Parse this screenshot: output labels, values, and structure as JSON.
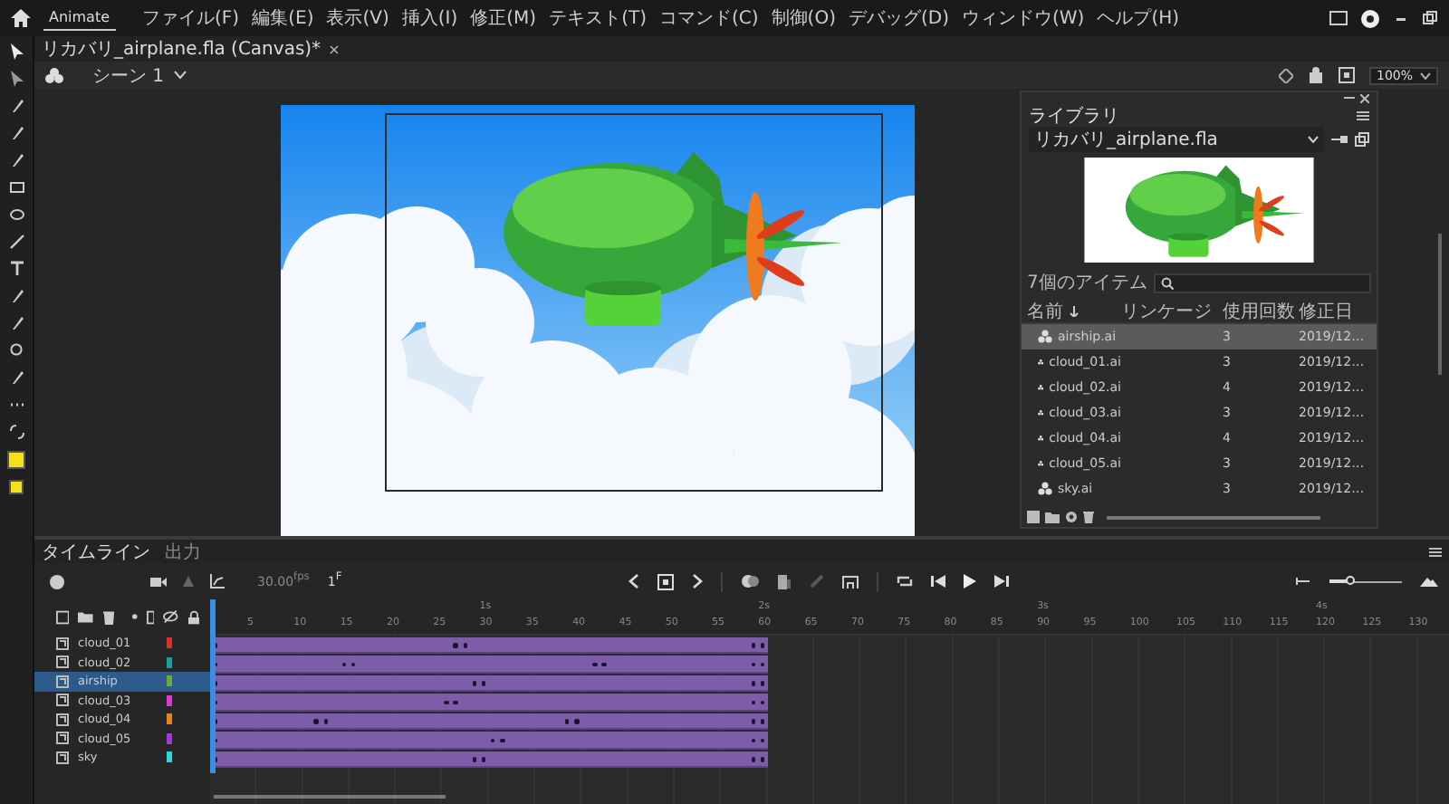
{
  "app": {
    "name": "Animate",
    "menus": [
      "ファイル(F)",
      "編集(E)",
      "表示(V)",
      "挿入(I)",
      "修正(M)",
      "テキスト(T)",
      "コマンド(C)",
      "制御(O)",
      "デバッグ(D)",
      "ウィンドウ(W)",
      "ヘルプ(H)"
    ]
  },
  "document_tab": {
    "title": "リカバリ_airplane.fla (Canvas)*",
    "close": "×"
  },
  "scene": {
    "label": "シーン 1"
  },
  "zoom": {
    "value": "100%"
  },
  "library": {
    "title": "ライブラリ",
    "file": "リカバリ_airplane.fla",
    "item_count": "7個のアイテム",
    "columns": [
      "名前",
      "リンケージ",
      "使用回数",
      "修正日"
    ],
    "items": [
      {
        "name": "airship.ai",
        "uses": "3",
        "modified": "2019/12…",
        "selected": true
      },
      {
        "name": "cloud_01.ai",
        "uses": "3",
        "modified": "2019/12…",
        "selected": false
      },
      {
        "name": "cloud_02.ai",
        "uses": "4",
        "modified": "2019/12…",
        "selected": false
      },
      {
        "name": "cloud_03.ai",
        "uses": "3",
        "modified": "2019/12…",
        "selected": false
      },
      {
        "name": "cloud_04.ai",
        "uses": "4",
        "modified": "2019/12…",
        "selected": false
      },
      {
        "name": "cloud_05.ai",
        "uses": "3",
        "modified": "2019/12…",
        "selected": false
      },
      {
        "name": "sky.ai",
        "uses": "3",
        "modified": "2019/12…",
        "selected": false
      }
    ]
  },
  "timeline": {
    "tabs": [
      {
        "label": "タイムライン",
        "selected": true
      },
      {
        "label": "出力",
        "selected": false
      }
    ],
    "fps": "30.00$^{fps}$",
    "frame": "1$^{F}$",
    "zoom": {
      "level": 0.3
    },
    "seconds": [
      "1s",
      "2s",
      "3s",
      "4s"
    ],
    "ruler": [
      "5",
      "10",
      "15",
      "20",
      "25",
      "30",
      "35",
      "40",
      "45",
      "50",
      "55",
      "60",
      "65",
      "70",
      "75",
      "80",
      "85",
      "90",
      "95",
      "100",
      "105",
      "110",
      "115",
      "120",
      "125",
      "130"
    ],
    "layers": [
      {
        "name": "cloud_01",
        "color": "#d8332a",
        "selected": false
      },
      {
        "name": "cloud_02",
        "color": "#1f9c9c",
        "selected": false
      },
      {
        "name": "airship",
        "color": "#6fa83a",
        "selected": true
      },
      {
        "name": "cloud_03",
        "color": "#d63ad6",
        "selected": false
      },
      {
        "name": "cloud_04",
        "color": "#e8821e",
        "selected": false
      },
      {
        "name": "cloud_05",
        "color": "#a23ad8",
        "selected": false
      },
      {
        "name": "sky",
        "color": "#2ad8e0",
        "selected": false
      }
    ]
  }
}
